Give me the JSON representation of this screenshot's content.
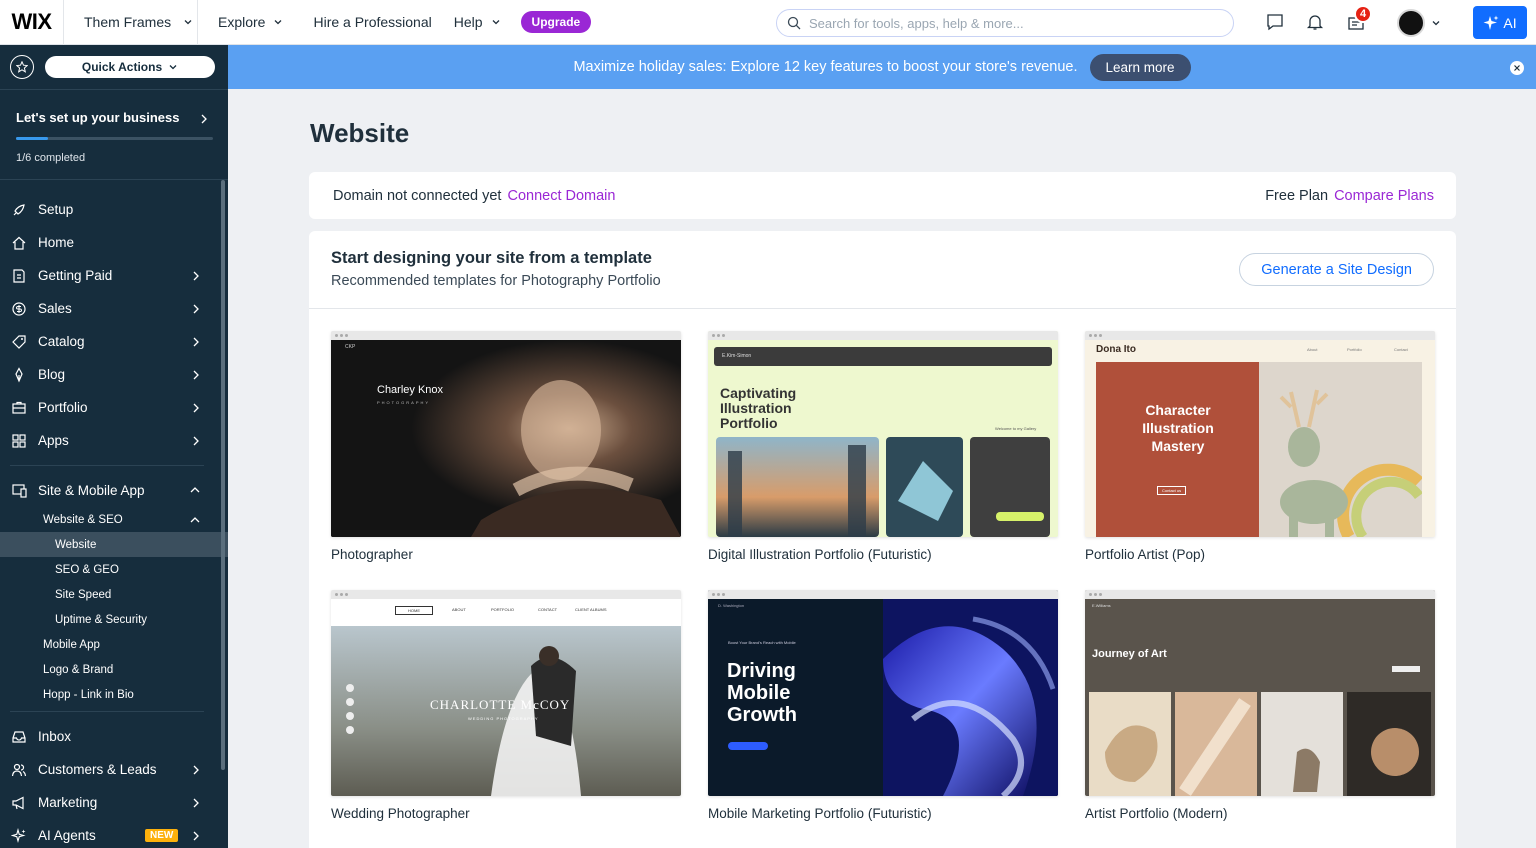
{
  "topbar": {
    "logo": "WIX",
    "site_name": "Them Frames",
    "nav": [
      "Explore",
      "Hire a Professional",
      "Help"
    ],
    "upgrade": "Upgrade",
    "search_placeholder": "Search for tools, apps, help & more...",
    "notification_count": "4",
    "ai_label": "AI"
  },
  "sidebar": {
    "quick_actions": "Quick Actions",
    "setup_title": "Let's set up your business",
    "setup_progress": "1/6 completed",
    "setup_fraction": 0.16,
    "items": [
      {
        "label": "Setup",
        "icon": "rocket-icon",
        "arrow": false
      },
      {
        "label": "Home",
        "icon": "home-icon",
        "arrow": false
      },
      {
        "label": "Getting Paid",
        "icon": "invoice-icon",
        "arrow": true
      },
      {
        "label": "Sales",
        "icon": "dollar-icon",
        "arrow": true
      },
      {
        "label": "Catalog",
        "icon": "tag-icon",
        "arrow": true
      },
      {
        "label": "Blog",
        "icon": "pen-icon",
        "arrow": true
      },
      {
        "label": "Portfolio",
        "icon": "portfolio-icon",
        "arrow": true
      },
      {
        "label": "Apps",
        "icon": "apps-icon",
        "arrow": true
      }
    ],
    "site_mobile_app": "Site & Mobile App",
    "sub_items": [
      {
        "label": "Website & SEO",
        "level": 1,
        "expanded": true
      },
      {
        "label": "Website",
        "level": 2,
        "active": true
      },
      {
        "label": "SEO & GEO",
        "level": 2
      },
      {
        "label": "Site Speed",
        "level": 2
      },
      {
        "label": "Uptime & Security",
        "level": 2
      },
      {
        "label": "Mobile App",
        "level": 1
      },
      {
        "label": "Logo & Brand",
        "level": 1
      },
      {
        "label": "Hopp - Link in Bio",
        "level": 1
      }
    ],
    "bottom_items": [
      {
        "label": "Inbox",
        "icon": "inbox-icon",
        "arrow": false
      },
      {
        "label": "Customers & Leads",
        "icon": "people-icon",
        "arrow": true
      },
      {
        "label": "Marketing",
        "icon": "megaphone-icon",
        "arrow": true
      },
      {
        "label": "AI Agents",
        "icon": "sparkle-icon",
        "arrow": true,
        "badge": "NEW"
      }
    ]
  },
  "banner": {
    "text": "Maximize holiday sales: Explore 12 key features to boost your store's revenue.",
    "button": "Learn more"
  },
  "main": {
    "title": "Website",
    "domain_status": "Domain not connected yet",
    "connect_domain": "Connect Domain",
    "plan": "Free Plan",
    "compare_plans": "Compare Plans",
    "template_title": "Start designing your site from a template",
    "template_subtitle": "Recommended templates for Photography Portfolio",
    "generate_button": "Generate a Site Design",
    "templates": [
      {
        "name": "Photographer",
        "heading": "Charley Knox",
        "tagline": "PHOTOGRAPHY",
        "brand": "CKP"
      },
      {
        "name": "Digital Illustration Portfolio (Futuristic)",
        "heading": "Captivating Illustration Portfolio",
        "brand": "E.Kim-Simon",
        "tagline": "Welcome to my Gallery"
      },
      {
        "name": "Portfolio Artist (Pop)",
        "heading": "Character Illustration Mastery",
        "brand": "Dona Ito",
        "nav": [
          "About",
          "Portfolio",
          "Contact"
        ],
        "button": "Contact us"
      },
      {
        "name": "Wedding Photographer",
        "heading": "CHARLOTTE McCOY",
        "tagline": "WEDDING PHOTOGRAPHY",
        "nav": [
          "HOME",
          "ABOUT",
          "PORTFOLIO",
          "CONTACT",
          "CLIENT ALBUMS"
        ]
      },
      {
        "name": "Mobile Marketing Portfolio (Futuristic)",
        "heading": "Driving Mobile Growth",
        "tagline": "Boost Your Brand's Reach with Mobile",
        "brand": "D. Washington"
      },
      {
        "name": "Artist Portfolio (Modern)",
        "heading": "Journey of Art",
        "brand": "E.Williams"
      }
    ]
  }
}
